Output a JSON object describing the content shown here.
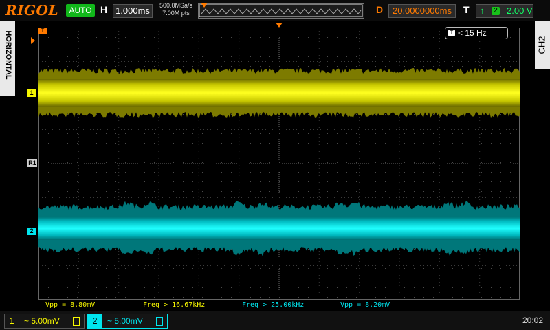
{
  "header": {
    "brand": "RIGOL",
    "run_state": "AUTO",
    "h_label": "H",
    "timebase": "1.000ms",
    "sample_rate": "500.0MSa/s",
    "memory_depth": "7.00M pts",
    "delay_label": "D",
    "delay": "20.0000000ms",
    "trigger_label": "T",
    "trigger_source": "2",
    "trigger_level": "2.00 V"
  },
  "side_tabs": {
    "left": "HORIZONTAL",
    "right": "CH2"
  },
  "screen": {
    "trigger_marker": "T",
    "freq_counter": "< 15 Hz",
    "freq_counter_icon": "T",
    "markers": {
      "ch1": "1",
      "ref": "R1",
      "ch2": "2"
    }
  },
  "measurements": [
    {
      "text": "Vpp = 8.80mV",
      "color": "#f5f500"
    },
    {
      "text": "Freq > 16.67kHz",
      "color": "#f5f500"
    },
    {
      "text": "Freq > 25.00kHz",
      "color": "#00e5ee"
    },
    {
      "text": "Vpp = 8.20mV",
      "color": "#00e5ee"
    }
  ],
  "channels": [
    {
      "number": "1",
      "scale": "~ 5.00mV",
      "color": "#f5f500"
    },
    {
      "number": "2",
      "scale": "~ 5.00mV",
      "color": "#00e5ee"
    }
  ],
  "clock": "20:02",
  "colors": {
    "accent": "#ff7a00",
    "ch1": "#f5f500",
    "ch2": "#00e5ee",
    "trigger": "#11ff66"
  }
}
